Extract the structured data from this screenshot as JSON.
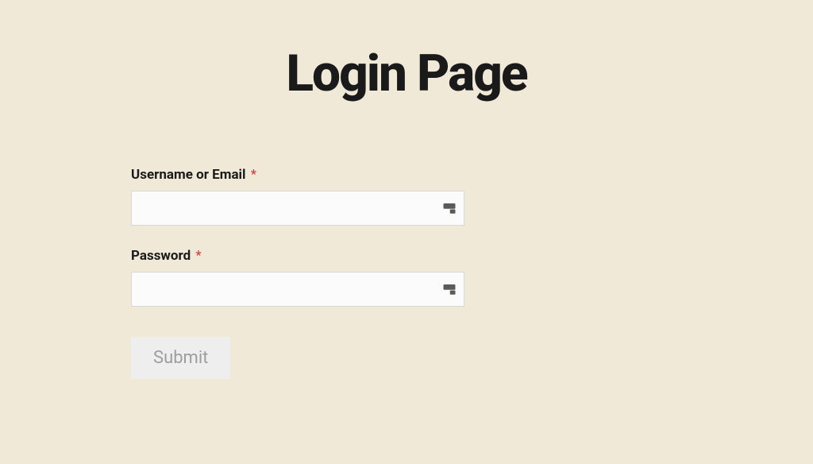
{
  "page": {
    "title": "Login Page"
  },
  "form": {
    "username": {
      "label": "Username or Email",
      "required_mark": "*",
      "value": ""
    },
    "password": {
      "label": "Password",
      "required_mark": "*",
      "value": ""
    },
    "submit_label": "Submit"
  },
  "icons": {
    "password_manager": "password-manager-icon"
  }
}
